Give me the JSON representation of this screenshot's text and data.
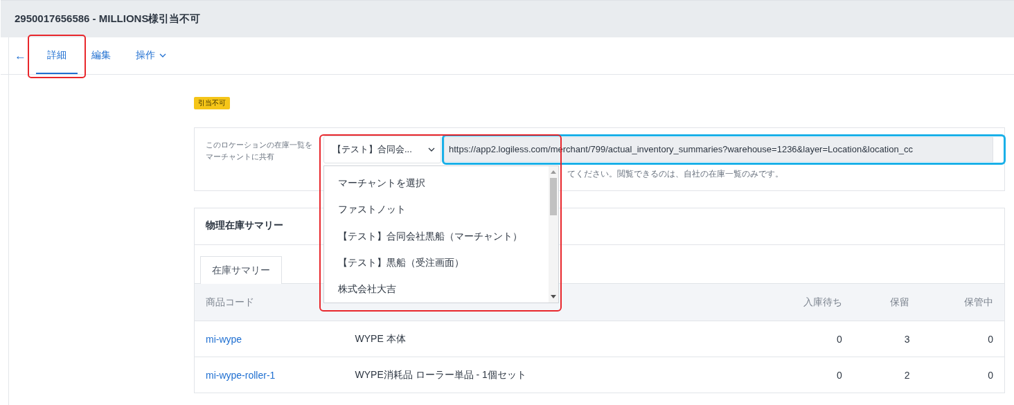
{
  "header": {
    "title": "2950017656586 - MILLIONS様引当不可"
  },
  "nav": {
    "back": "←",
    "tabs": [
      {
        "label": "詳細",
        "selected": true,
        "highlighted": true,
        "kind": "tab"
      },
      {
        "label": "編集",
        "selected": false,
        "highlighted": false,
        "kind": "tab"
      },
      {
        "label": "操作",
        "selected": false,
        "highlighted": false,
        "kind": "menu"
      }
    ]
  },
  "status_badge": "引当不可",
  "share": {
    "label": [
      "このロケーションの在庫一覧を",
      "マーチャントに共有"
    ],
    "select": {
      "value": "【テスト】合同会...",
      "expanded": true,
      "highlighted": true,
      "options": [
        "マーチャントを選択",
        "ファストノット",
        "【テスト】合同会社黒船（マーチャント）",
        "【テスト】黒船（受注画面）",
        "株式会社大吉"
      ]
    },
    "url": {
      "value": "https://app2.logiless.com/merchant/799/actual_inventory_summaries?warehouse=1236&layer=Location&location_cc",
      "highlighted": true
    },
    "hint": "てください。閲覧できるのは、自社の在庫一覧のみです。"
  },
  "summary": {
    "title": "物理在庫サマリー",
    "tabs": [
      {
        "label": "在庫サマリー",
        "selected": true
      }
    ],
    "table": {
      "columns": [
        "商品コード",
        "入庫待ち",
        "保留",
        "保管中"
      ],
      "rows": [
        {
          "code": "mi-wype",
          "name": "WYPE 本体",
          "incoming": "0",
          "hold": "3",
          "stored": "0"
        },
        {
          "code": "mi-wype-roller-1",
          "name": "WYPE消耗品 ローラー単品 - 1個セット",
          "incoming": "0",
          "hold": "2",
          "stored": "0"
        }
      ]
    }
  }
}
